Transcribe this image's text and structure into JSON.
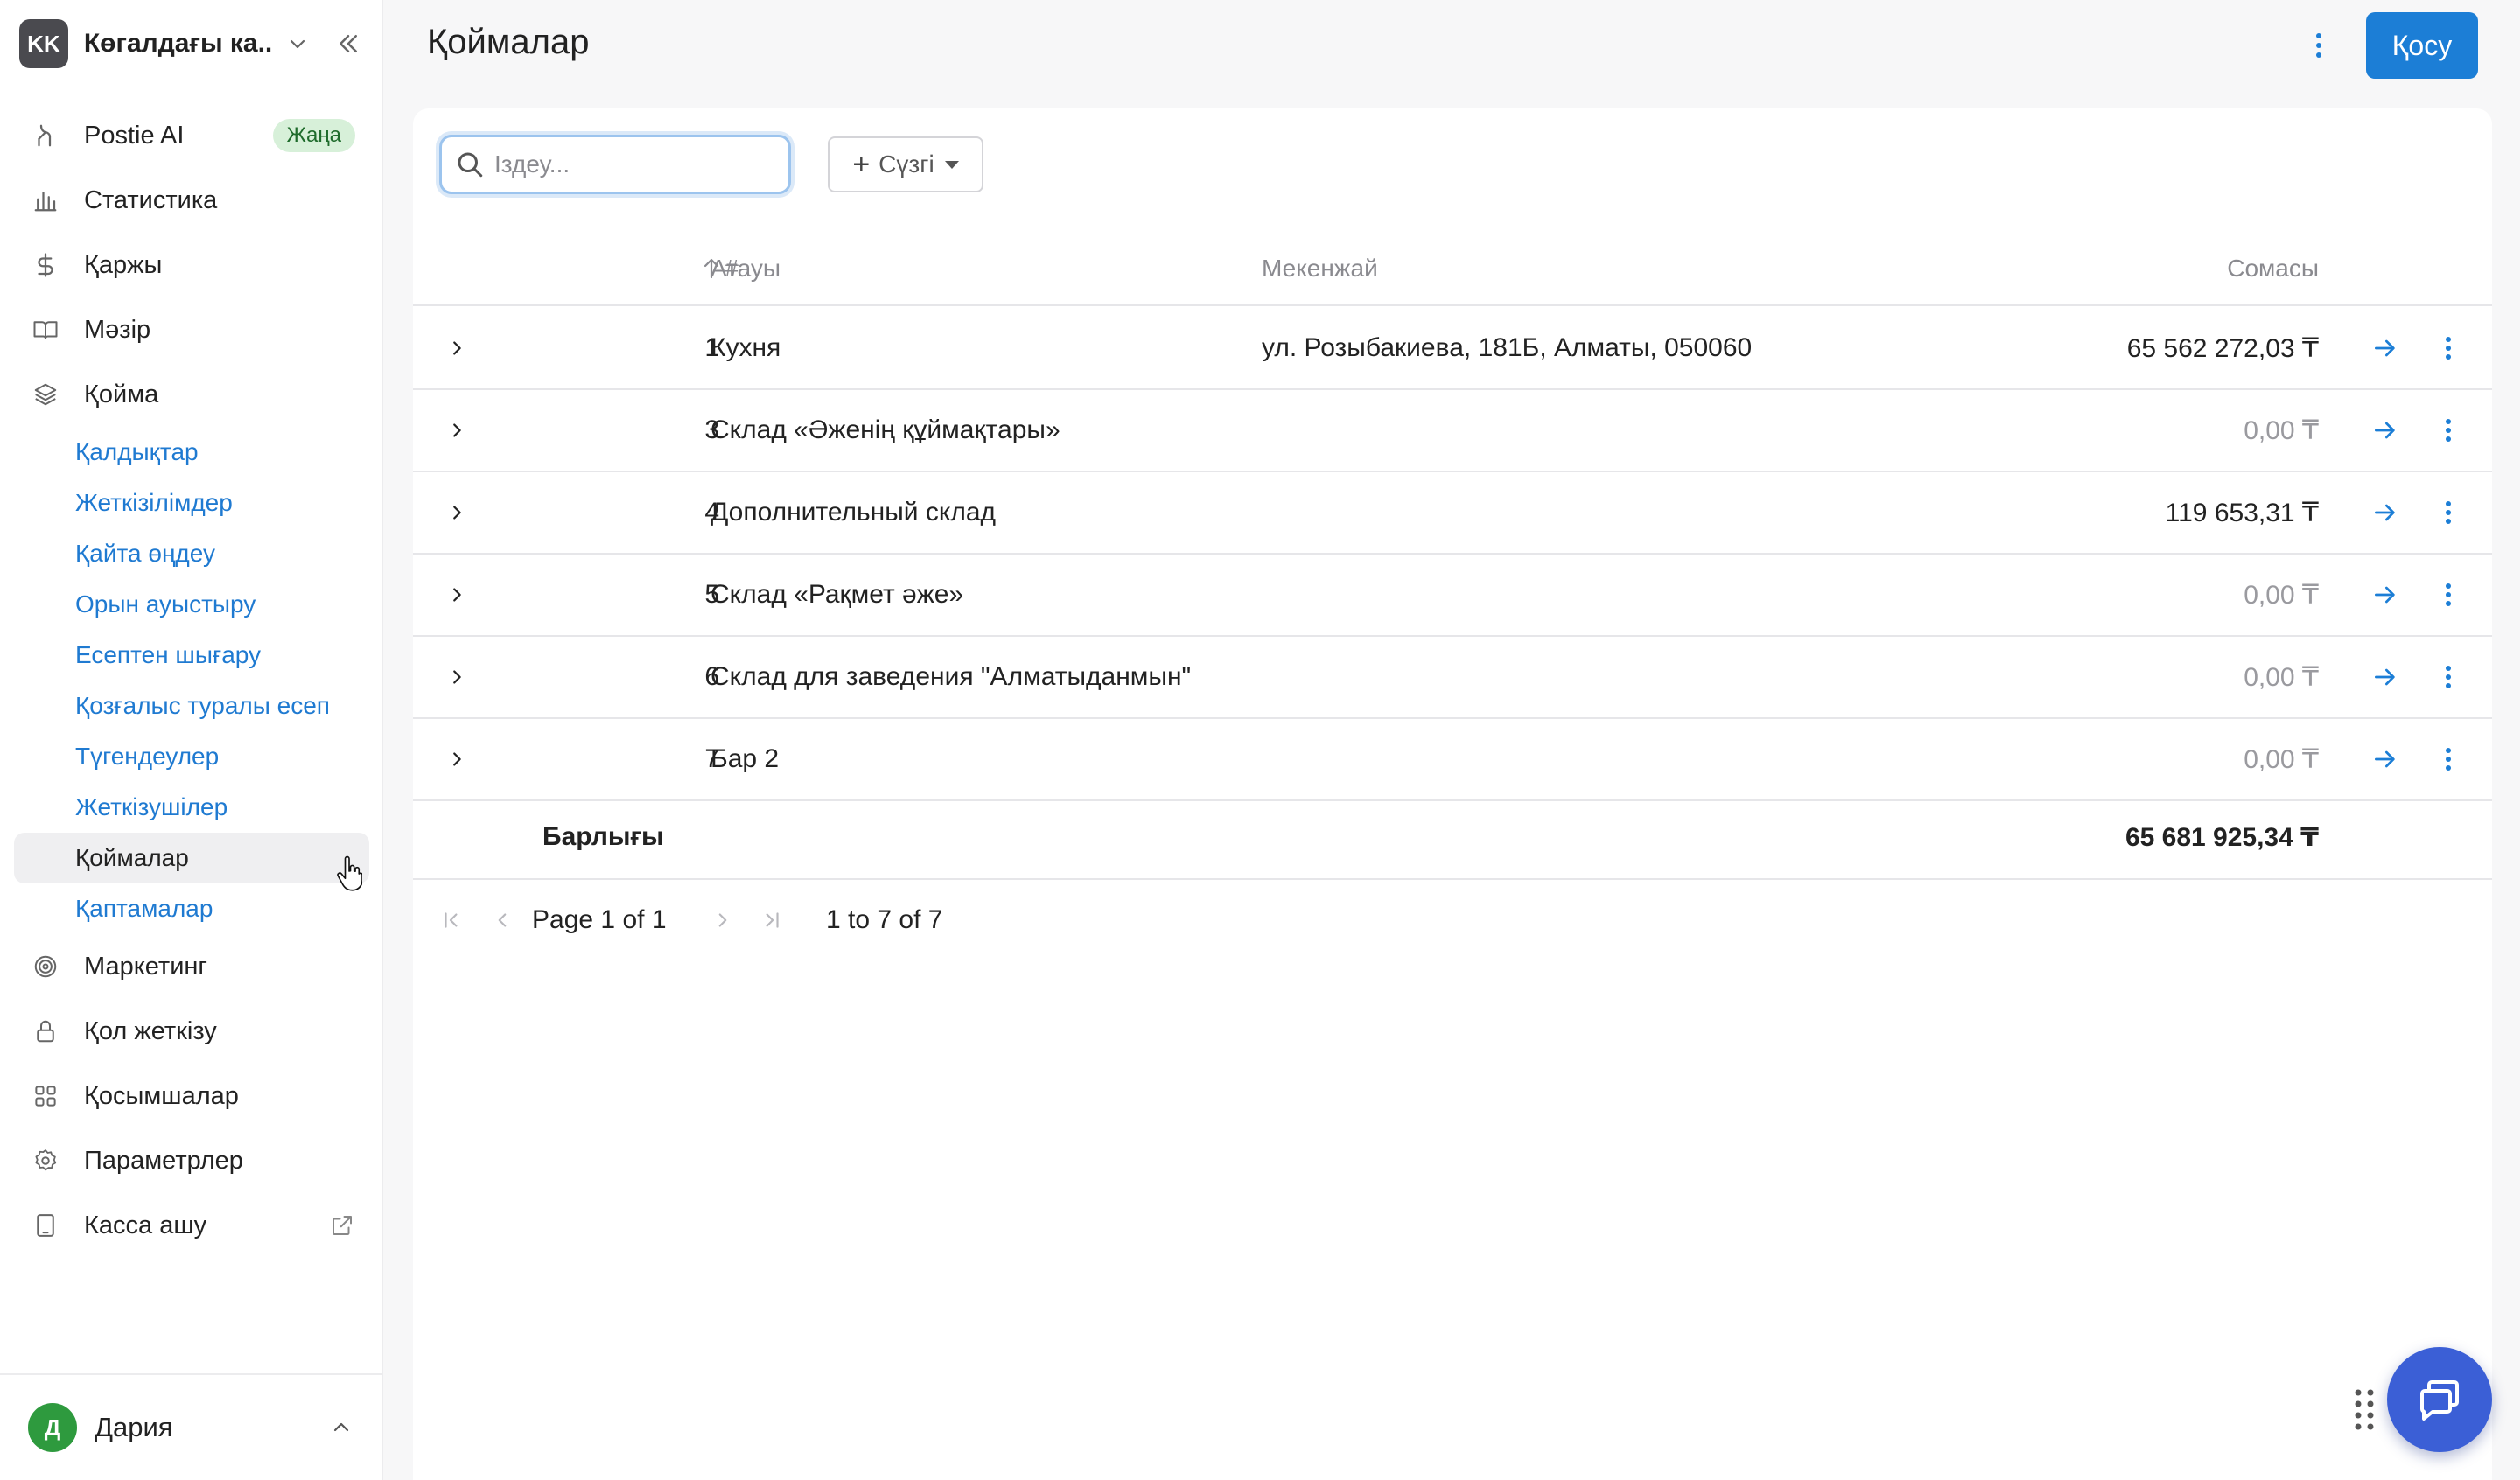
{
  "org": {
    "initials": "KK",
    "name": "Көгалдағы ка..."
  },
  "nav": {
    "postie_ai": {
      "label": "Postie AI",
      "badge": "Жаңа"
    },
    "statistics": "Статистика",
    "finance": "Қаржы",
    "menu": "Мәзір",
    "warehouse": "Қойма",
    "warehouse_sub": [
      "Қалдықтар",
      "Жеткізілімдер",
      "Қайта өңдеу",
      "Орын ауыстыру",
      "Есептен шығару",
      "Қозғалыс туралы есеп",
      "Түгендеулер",
      "Жеткізушілер",
      "Қоймалар",
      "Қаптамалар"
    ],
    "marketing": "Маркетинг",
    "access": "Қол жеткізу",
    "apps": "Қосымшалар",
    "settings": "Параметрлер",
    "open_register": "Касса ашу"
  },
  "user": {
    "initial": "Д",
    "name": "Дария"
  },
  "header": {
    "title": "Қоймалар",
    "add_button": "Қосу"
  },
  "toolbar": {
    "search_placeholder": "Іздеу...",
    "filter_label": "Сүзгі"
  },
  "table": {
    "columns": {
      "num": "#",
      "name": "Атауы",
      "address": "Мекенжай",
      "sum": "Сомасы"
    },
    "rows": [
      {
        "num": "1",
        "name": "Кухня",
        "address": "ул. Розыбакиева, 181Б, Алматы, 050060",
        "sum": "65 562 272,03 ₸"
      },
      {
        "num": "3",
        "name": "Склад «Әженің құймақтары»",
        "address": "",
        "sum": "0,00 ₸"
      },
      {
        "num": "4",
        "name": "Дополнительный склад",
        "address": "",
        "sum": "119 653,31 ₸"
      },
      {
        "num": "5",
        "name": "Склад «Рақмет әже»",
        "address": "",
        "sum": "0,00 ₸"
      },
      {
        "num": "6",
        "name": "Склад для заведения \"Алматыданмын\"",
        "address": "",
        "sum": "0,00 ₸"
      },
      {
        "num": "7",
        "name": "Бар 2",
        "address": "",
        "sum": "0,00 ₸"
      }
    ],
    "total_label": "Барлығы",
    "total_sum": "65 681 925,34 ₸"
  },
  "pagination": {
    "page_word": "Page",
    "current": "1",
    "of_word": "of",
    "total_pages": "1",
    "range": "1 to 7 of 7"
  },
  "colors": {
    "accent": "#1c7ed6",
    "link": "#1f7ad1",
    "chat": "#3b5fd6",
    "badge_bg": "#d7f0d9",
    "badge_text": "#1e6b2b"
  }
}
